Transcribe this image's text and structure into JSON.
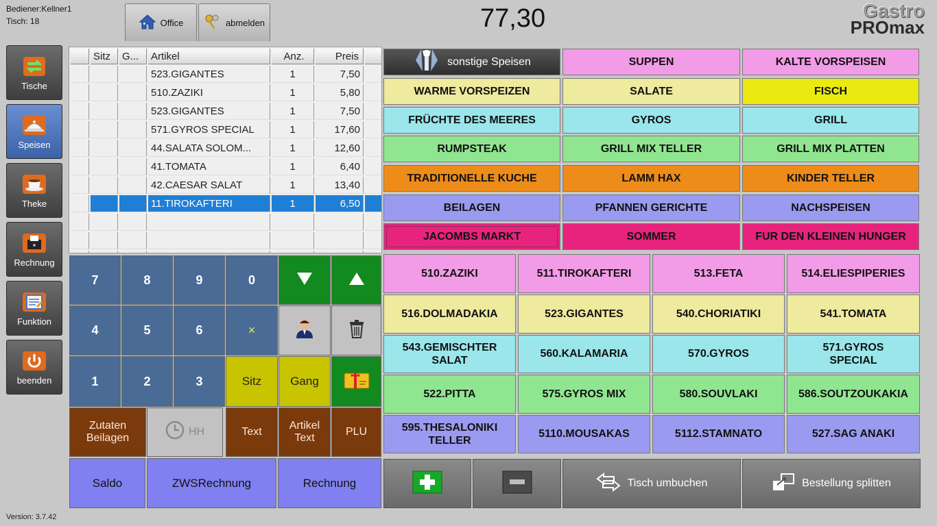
{
  "header": {
    "user": "Bediener:Kellner1",
    "table": "Tisch: 18",
    "office_label": "Office",
    "logout_label": "abmelden",
    "total": "77,30",
    "brand_line1": "Gastro",
    "brand_line2": "PROmax"
  },
  "nav": [
    {
      "label": "Tische",
      "icon": "tables-icon",
      "active": false
    },
    {
      "label": "Speisen",
      "icon": "food-cloche-icon",
      "active": true
    },
    {
      "label": "Theke",
      "icon": "coffee-cup-icon",
      "active": false
    },
    {
      "label": "Rechnung",
      "icon": "receipt-printer-icon",
      "active": false
    },
    {
      "label": "Funktion",
      "icon": "function-form-icon",
      "active": false
    },
    {
      "label": "beenden",
      "icon": "power-icon",
      "active": false
    }
  ],
  "orders": {
    "columns": [
      "Sitz",
      "G...",
      "Artikel",
      "Anz.",
      "Preis"
    ],
    "rows": [
      {
        "sitz": "",
        "gang": "",
        "artikel": "523.GIGANTES",
        "anz": "1",
        "preis": "7,50"
      },
      {
        "sitz": "",
        "gang": "",
        "artikel": "510.ZAZIKI",
        "anz": "1",
        "preis": "5,80"
      },
      {
        "sitz": "",
        "gang": "",
        "artikel": "523.GIGANTES",
        "anz": "1",
        "preis": "7,50"
      },
      {
        "sitz": "",
        "gang": "",
        "artikel": "571.GYROS SPECIAL",
        "anz": "1",
        "preis": "17,60"
      },
      {
        "sitz": "",
        "gang": "",
        "artikel": "44.SALATA SOLOM...",
        "anz": "1",
        "preis": "12,60"
      },
      {
        "sitz": "",
        "gang": "",
        "artikel": "41.TOMATA",
        "anz": "1",
        "preis": "6,40"
      },
      {
        "sitz": "",
        "gang": "",
        "artikel": "42.CAESAR SALAT",
        "anz": "1",
        "preis": "13,40"
      },
      {
        "sitz": "",
        "gang": "",
        "artikel": "11.TIROKAFTERI",
        "anz": "1",
        "preis": "6,50"
      }
    ],
    "selected_row": 7
  },
  "keypad": {
    "digits": [
      "7",
      "8",
      "9",
      "0",
      "4",
      "5",
      "6",
      "1",
      "2",
      "3"
    ],
    "times": "×",
    "sitz": "Sitz",
    "gang": "Gang",
    "zutaten": "Zutaten Beilagen",
    "hh": "HH",
    "text": "Text",
    "artikel_text": "Artikel Text",
    "plu": "PLU",
    "saldo": "Saldo",
    "zws": "ZWSRechnung",
    "rechnung": "Rechnung"
  },
  "categories": [
    {
      "label": "sonstige Speisen",
      "color": "#3c3c3c",
      "text": "#ffffff"
    },
    {
      "label": "SUPPEN",
      "color": "#f29be6"
    },
    {
      "label": "KALTE VORSPEISEN",
      "color": "#f29be6"
    },
    {
      "label": "WARME VORSPEIZEN",
      "color": "#eeea9e"
    },
    {
      "label": "SALATE",
      "color": "#eeea9e"
    },
    {
      "label": "FISCH",
      "color": "#eaea10"
    },
    {
      "label": "FRÜCHTE DES MEERES",
      "color": "#9ae6ea"
    },
    {
      "label": "GYROS",
      "color": "#9ae6ea"
    },
    {
      "label": "GRILL",
      "color": "#9ae6ea"
    },
    {
      "label": "RUMPSTEAK",
      "color": "#90e690"
    },
    {
      "label": "GRILL MIX TELLER",
      "color": "#90e690"
    },
    {
      "label": "GRILL MIX PLATTEN",
      "color": "#90e690"
    },
    {
      "label": "TRADITIONELLE KUCHE",
      "color": "#ee8c1a"
    },
    {
      "label": "LAMM HAX",
      "color": "#ee8c1a"
    },
    {
      "label": "KINDER TELLER",
      "color": "#ee8c1a"
    },
    {
      "label": "BEILAGEN",
      "color": "#9a9af0"
    },
    {
      "label": "PFANNEN GERICHTE",
      "color": "#9a9af0"
    },
    {
      "label": "NACHSPEISEN",
      "color": "#9a9af0"
    },
    {
      "label": "JACOMBS MARKT",
      "color": "#e8237e"
    },
    {
      "label": "SOMMER",
      "color": "#e8237e"
    },
    {
      "label": "FUR DEN KLEINEN HUNGER",
      "color": "#e8237e"
    }
  ],
  "items": [
    {
      "label": "510.ZAZIKI",
      "color": "#f29be6"
    },
    {
      "label": "511.TIROKAFTERI",
      "color": "#f29be6"
    },
    {
      "label": "513.FETA",
      "color": "#f29be6"
    },
    {
      "label": "514.ELIESPIPERIES",
      "color": "#f29be6"
    },
    {
      "label": "516.DOLMADAKIA",
      "color": "#eeea9e"
    },
    {
      "label": "523.GIGANTES",
      "color": "#eeea9e"
    },
    {
      "label": "540.CHORIATIKI",
      "color": "#eeea9e"
    },
    {
      "label": "541.TOMATA",
      "color": "#eeea9e"
    },
    {
      "label": "543.GEMISCHTER SALAT",
      "color": "#9ae6ea"
    },
    {
      "label": "560.KALAMARIA",
      "color": "#9ae6ea"
    },
    {
      "label": "570.GYROS",
      "color": "#9ae6ea"
    },
    {
      "label": "571.GYROS SPECIAL",
      "color": "#9ae6ea"
    },
    {
      "label": "522.PITTA",
      "color": "#90e690"
    },
    {
      "label": "575.GYROS MIX",
      "color": "#90e690"
    },
    {
      "label": "580.SOUVLAKI",
      "color": "#90e690"
    },
    {
      "label": "586.SOUTZOUKAKIA",
      "color": "#90e690"
    },
    {
      "label": "595.THESALONIKI TELLER",
      "color": "#9a9af0"
    },
    {
      "label": "5110.MOUSAKAS",
      "color": "#9a9af0"
    },
    {
      "label": "5112.STAMNATO",
      "color": "#9a9af0"
    },
    {
      "label": "527.SAG ANAKI",
      "color": "#9a9af0"
    }
  ],
  "bottom": {
    "tisch_umbuchen": "Tisch umbuchen",
    "bestellung_splitten": "Bestellung splitten"
  },
  "version": "Version: 3.7.42"
}
